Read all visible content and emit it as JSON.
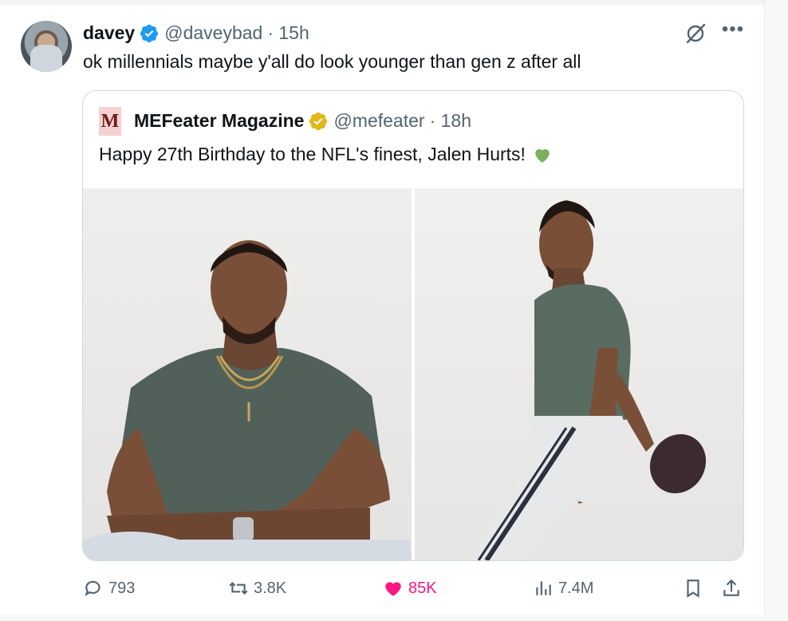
{
  "author": {
    "name": "davey",
    "handle": "@daveybad",
    "time": "· 15h",
    "text": "ok millennials maybe y'all do look younger than gen z after all"
  },
  "quoted": {
    "logo_letter": "M",
    "name": "MEFeater Magazine",
    "handle": "@mefeater",
    "time": "· 18h",
    "text": "Happy 27th Birthday to the NFL's finest, Jalen Hurts!"
  },
  "actions": {
    "replies": "793",
    "retweets": "3.8K",
    "likes": "85K",
    "views": "7.4M"
  },
  "colors": {
    "verified_blue": "#1d9bf0",
    "verified_gold": "#e2b719",
    "like_pink": "#f91880",
    "muted": "#536471"
  },
  "icons": [
    "verified-badge-icon",
    "grok-icon",
    "more-icon",
    "gold-verified-icon",
    "green-heart-icon",
    "reply-icon",
    "retweet-icon",
    "like-icon",
    "views-icon",
    "bookmark-icon",
    "share-icon"
  ]
}
